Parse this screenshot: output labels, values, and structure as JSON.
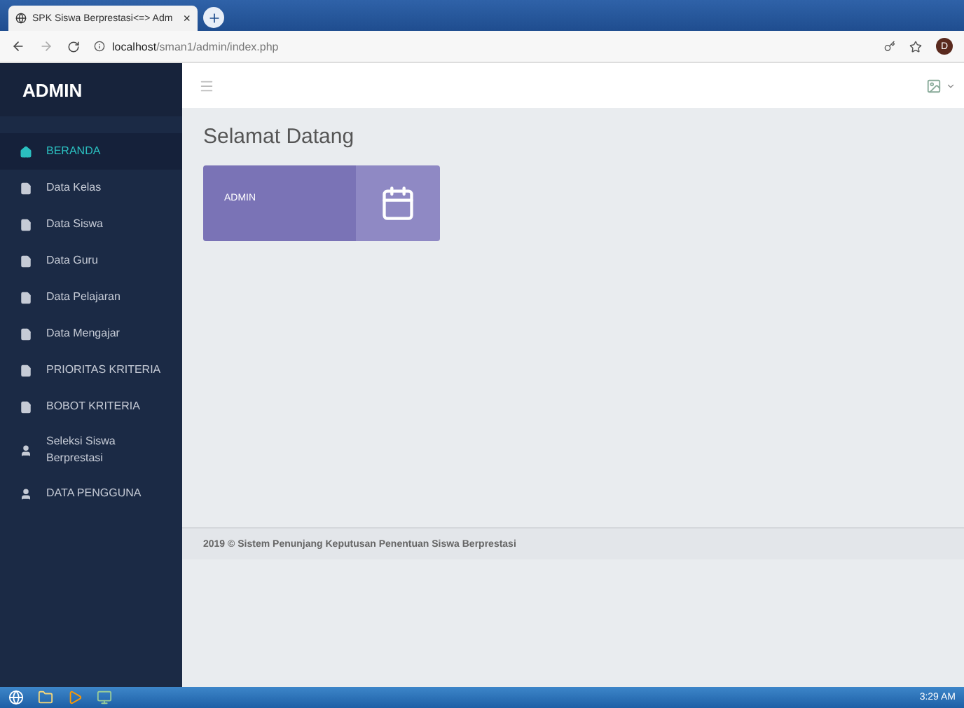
{
  "browser": {
    "tab_title": "SPK Siswa Berprestasi<=> Adm",
    "tab_close": "×",
    "url_host": "localhost",
    "url_path": "/sman1/admin/index.php",
    "profile": "D"
  },
  "sidebar": {
    "title": "ADMIN",
    "items": [
      {
        "label": "BERANDA",
        "kind": "home",
        "selected": true
      },
      {
        "label": "Data Kelas",
        "kind": "doc",
        "selected": false
      },
      {
        "label": "Data Siswa",
        "kind": "doc",
        "selected": false
      },
      {
        "label": "Data Guru",
        "kind": "doc",
        "selected": false
      },
      {
        "label": "Data Pelajaran",
        "kind": "doc",
        "selected": false
      },
      {
        "label": "Data Mengajar",
        "kind": "doc",
        "selected": false
      },
      {
        "label": "PRIORITAS KRITERIA",
        "kind": "doc",
        "selected": false
      },
      {
        "label": "BOBOT KRITERIA",
        "kind": "doc",
        "selected": false
      },
      {
        "label": "Seleksi Siswa Berprestasi",
        "kind": "user",
        "selected": false
      },
      {
        "label": "DATA PENGGUNA",
        "kind": "user",
        "selected": false
      }
    ]
  },
  "main": {
    "heading": "Selamat Datang",
    "card": {
      "label": "ADMIN"
    },
    "footer": "2019 © Sistem Penunjang Keputusan Penentuan Siswa Berprestasi"
  },
  "taskbar": {
    "clock": "3:29 AM"
  }
}
